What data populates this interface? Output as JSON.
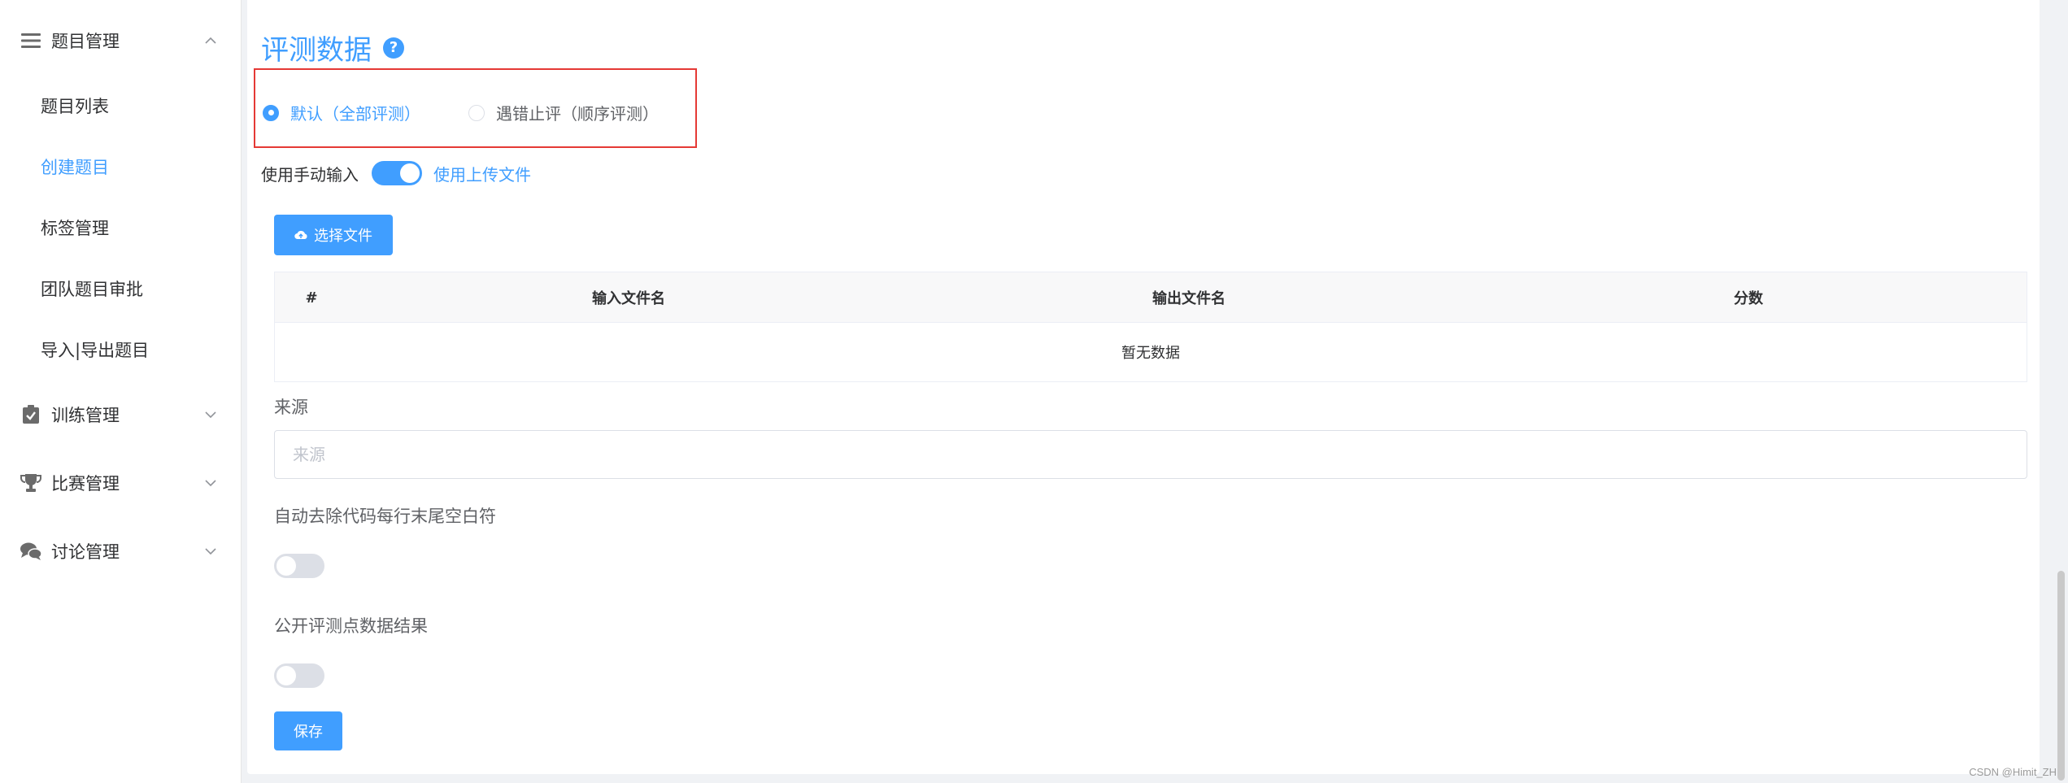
{
  "sidebar": {
    "groups": [
      {
        "label": "题目管理",
        "icon": "menu-lines-icon",
        "expanded": true
      },
      {
        "label": "训练管理",
        "icon": "clipboard-check-icon",
        "expanded": false
      },
      {
        "label": "比赛管理",
        "icon": "trophy-icon",
        "expanded": false
      },
      {
        "label": "讨论管理",
        "icon": "chat-bubbles-icon",
        "expanded": false
      }
    ],
    "problem_items": [
      {
        "label": "题目列表",
        "active": false
      },
      {
        "label": "创建题目",
        "active": true
      },
      {
        "label": "标签管理",
        "active": false
      },
      {
        "label": "团队题目审批",
        "active": false
      },
      {
        "label": "导入|导出题目",
        "active": false
      }
    ]
  },
  "main": {
    "section_title": "评测数据",
    "help_icon_glyph": "?",
    "judge_modes": [
      {
        "label": "默认（全部评测）",
        "checked": true
      },
      {
        "label": "遇错止评（顺序评测）",
        "checked": false
      }
    ],
    "input_mode": {
      "manual_label": "使用手动输入",
      "upload_label": "使用上传文件",
      "upload_selected": true
    },
    "upload_button_label": "选择文件",
    "table": {
      "columns": [
        "#",
        "输入文件名",
        "输出文件名",
        "分数"
      ],
      "empty_text": "暂无数据"
    },
    "source": {
      "label": "来源",
      "placeholder": "来源",
      "value": ""
    },
    "auto_trim": {
      "label": "自动去除代码每行末尾空白符",
      "enabled": false
    },
    "public_results": {
      "label": "公开评测点数据结果",
      "enabled": false
    },
    "save_label": "保存"
  },
  "watermark": "CSDN @Himit_ZH",
  "colors": {
    "accent": "#409eff",
    "highlight_border": "#e53935",
    "text_primary": "#303133",
    "text_regular": "#606266",
    "placeholder": "#c0c4cc"
  }
}
